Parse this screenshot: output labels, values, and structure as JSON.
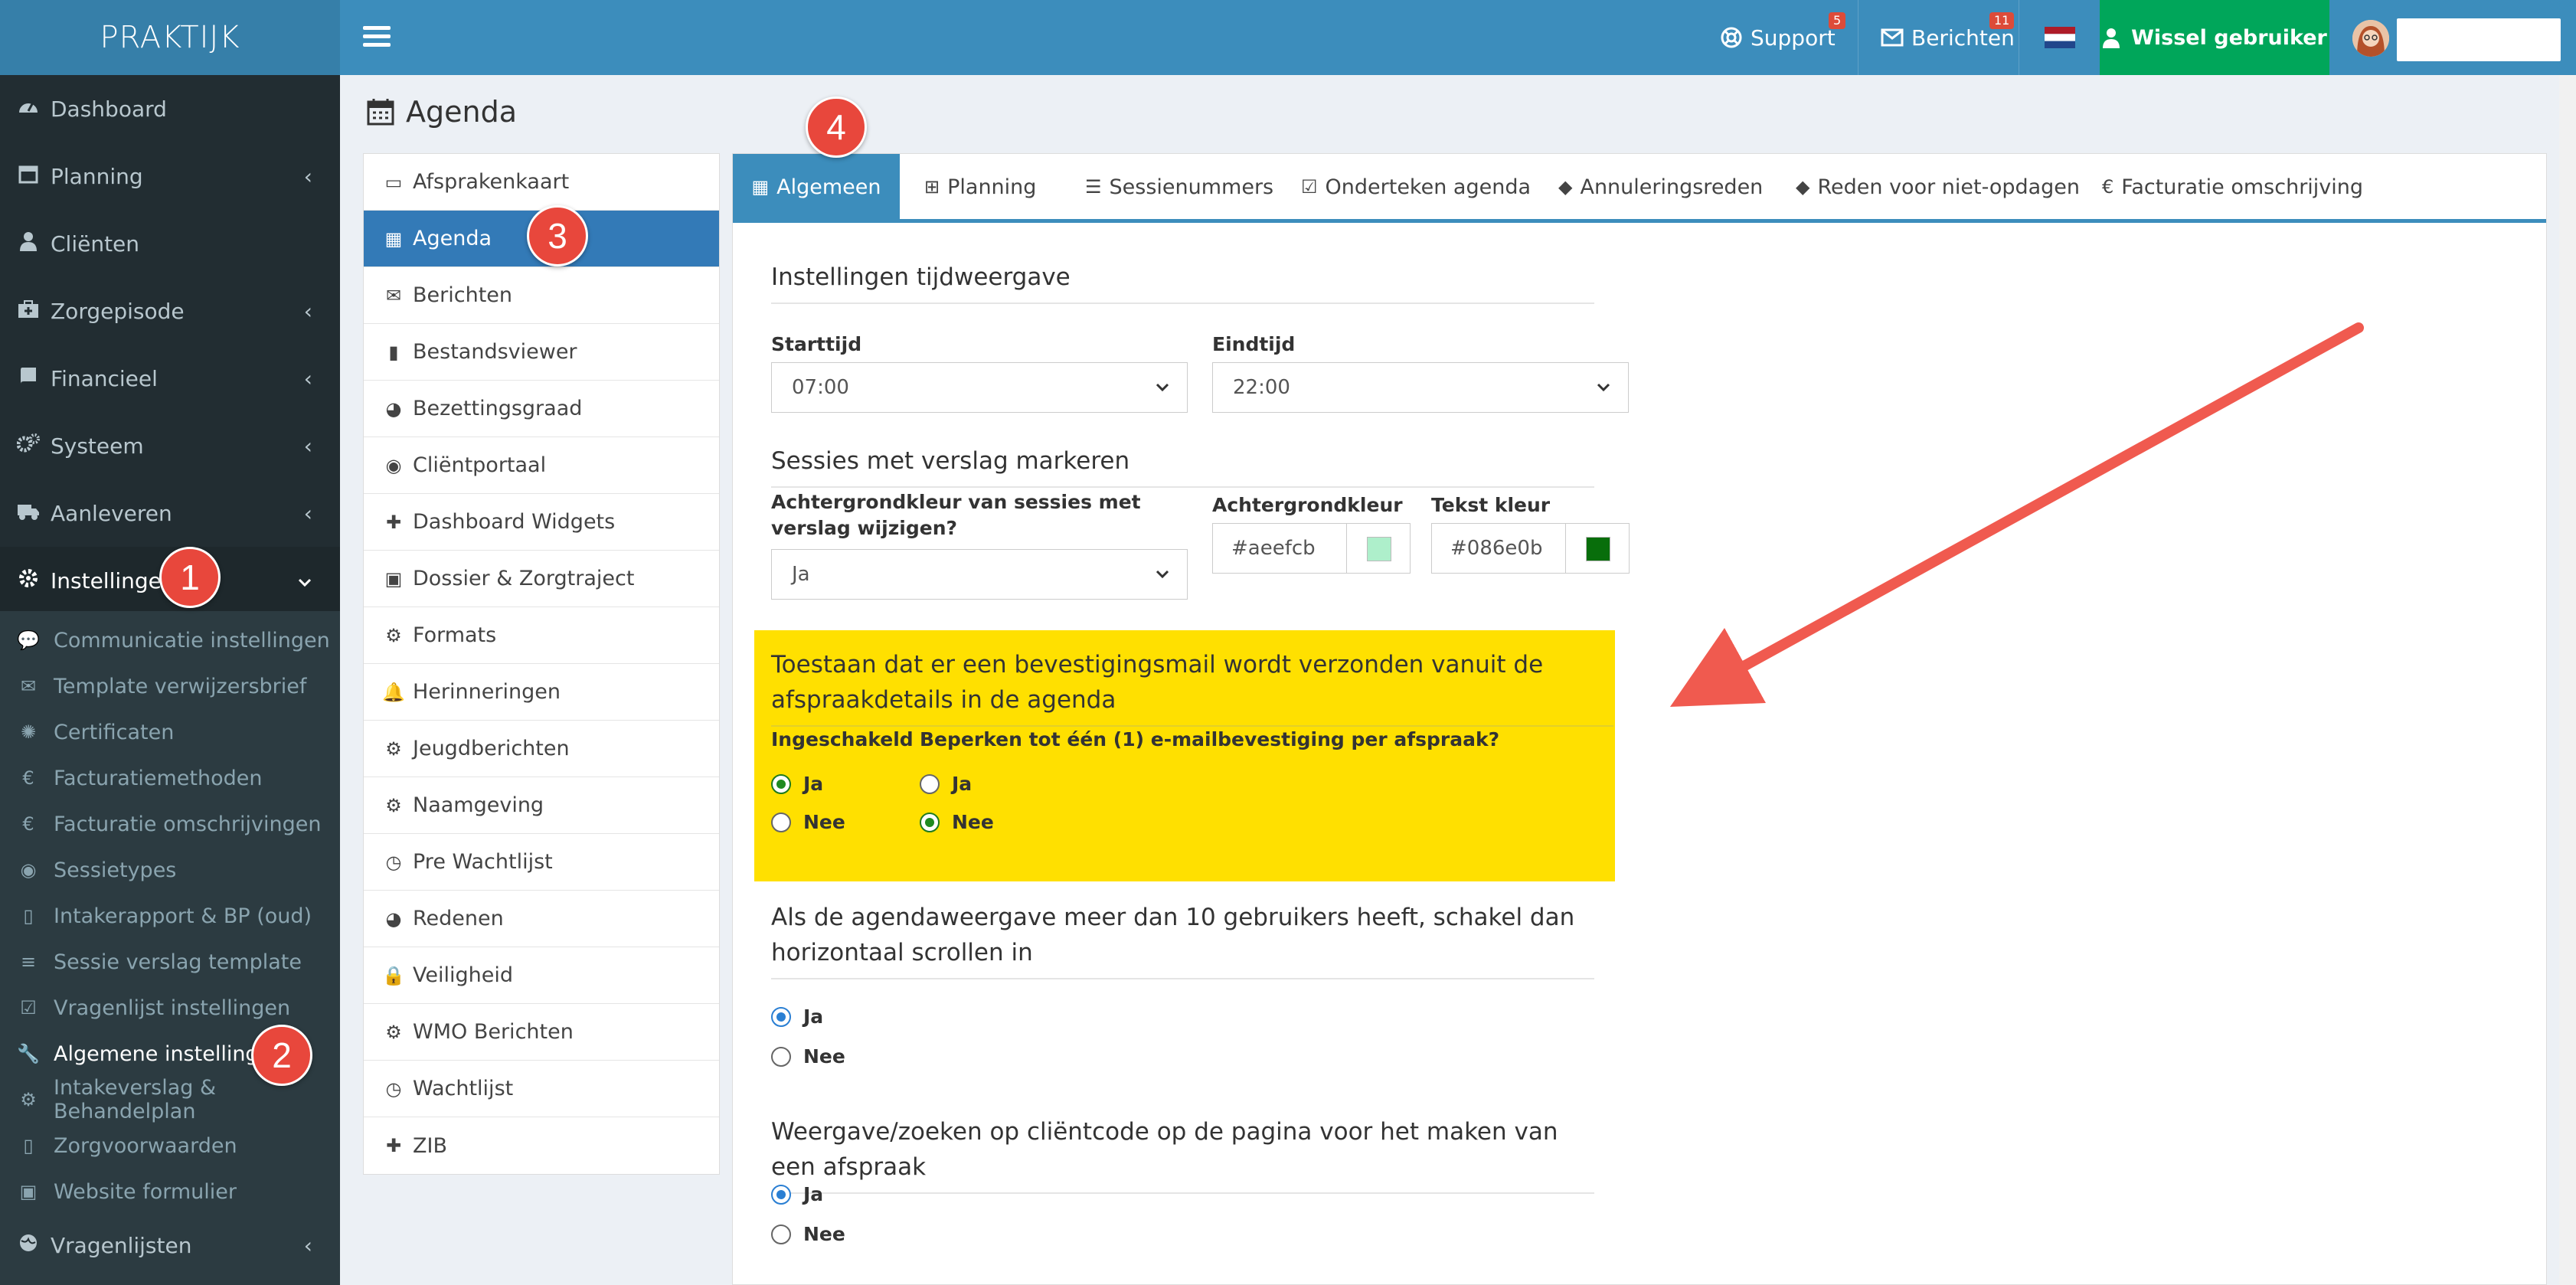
{
  "app": {
    "logo": "PRAKTIJK"
  },
  "topbar": {
    "support_label": "Support",
    "support_badge": "5",
    "berichten_label": "Berichten",
    "berichten_badge": "11",
    "wissel_label": "Wissel gebruiker",
    "flag_icon": "nl-flag-icon"
  },
  "sidebar": {
    "items": [
      {
        "label": "Dashboard",
        "icon": "dashboard-icon"
      },
      {
        "label": "Planning",
        "icon": "calendar-icon"
      },
      {
        "label": "Cliënten",
        "icon": "user-icon"
      },
      {
        "label": "Zorgepisode",
        "icon": "medkit-icon"
      },
      {
        "label": "Financieel",
        "icon": "book-icon"
      },
      {
        "label": "Systeem",
        "icon": "cogs-icon"
      },
      {
        "label": "Aanleveren",
        "icon": "truck-icon"
      },
      {
        "label": "Instellingen",
        "icon": "gear-icon"
      },
      {
        "label": "Vragenlijsten",
        "icon": "globe-icon"
      }
    ],
    "sub_items": [
      {
        "label": "Communicatie instellingen"
      },
      {
        "label": "Template verwijzersbrief"
      },
      {
        "label": "Certificaten"
      },
      {
        "label": "Facturatiemethoden"
      },
      {
        "label": "Facturatie omschrijvingen"
      },
      {
        "label": "Sessietypes"
      },
      {
        "label": "Intakerapport & BP (oud)"
      },
      {
        "label": "Sessie verslag template"
      },
      {
        "label": "Vragenlijst instellingen"
      },
      {
        "label": "Algemene instellingen"
      },
      {
        "label": "Intakeverslag & Behandelplan"
      },
      {
        "label": "Zorgvoorwaarden"
      },
      {
        "label": "Website formulier"
      }
    ]
  },
  "page": {
    "title": "Agenda"
  },
  "leftmenu": {
    "items": [
      {
        "label": "Afsprakenkaart"
      },
      {
        "label": "Agenda"
      },
      {
        "label": "Berichten"
      },
      {
        "label": "Bestandsviewer"
      },
      {
        "label": "Bezettingsgraad"
      },
      {
        "label": "Cliëntportaal"
      },
      {
        "label": "Dashboard Widgets"
      },
      {
        "label": "Dossier & Zorgtraject"
      },
      {
        "label": "Formats"
      },
      {
        "label": "Herinneringen"
      },
      {
        "label": "Jeugdberichten"
      },
      {
        "label": "Naamgeving"
      },
      {
        "label": "Pre Wachtlijst"
      },
      {
        "label": "Redenen"
      },
      {
        "label": "Veiligheid"
      },
      {
        "label": "WMO Berichten"
      },
      {
        "label": "Wachtlijst"
      },
      {
        "label": "ZIB"
      }
    ]
  },
  "tabs": [
    {
      "label": "Algemeen",
      "icon": "calendar-icon"
    },
    {
      "label": "Planning",
      "icon": "calendar-plus-icon"
    },
    {
      "label": "Sessienummers",
      "icon": "list-icon"
    },
    {
      "label": "Onderteken agenda",
      "icon": "calendar-check-icon"
    },
    {
      "label": "Annuleringsreden",
      "icon": "tag-icon"
    },
    {
      "label": "Reden voor niet-opdagen",
      "icon": "tag-icon"
    },
    {
      "label": "Facturatie omschrijving",
      "icon": "euro-icon"
    }
  ],
  "form": {
    "time_section_title": "Instellingen tijdweergave",
    "start_label": "Starttijd",
    "start_value": "07:00",
    "end_label": "Eindtijd",
    "end_value": "22:00",
    "sessions_section_title": "Sessies met verslag markeren",
    "bg_change_label": "Achtergrondkleur van sessies met verslag wijzigen?",
    "bg_change_value": "Ja",
    "bg_color_label": "Achtergrondkleur",
    "bg_color_value": "#aeefcb",
    "text_color_label": "Tekst kleur",
    "text_color_value": "#086e0b",
    "confirm_section_title": "Toestaan dat er een bevestigingsmail wordt verzonden vanuit de afspraakdetails in de agenda",
    "enabled_label": "Ingeschakeld",
    "limit_label": "Beperken tot één (1) e-mailbevestiging per afspraak?",
    "yes": "Ja",
    "no": "Nee",
    "scroll_section_title": "Als de agendaweergave meer dan 10 gebruikers heeft, schakel dan horizontaal scrollen in",
    "clientcode_section_title": "Weergave/zoeken op cliëntcode op de pagina voor het maken van een afspraak"
  },
  "callouts": [
    "1",
    "2",
    "3",
    "4"
  ],
  "colors": {
    "topbar": "#3c8dbc",
    "logo_bg": "#367fa9",
    "sidebar": "#222d32",
    "wissel": "#00a65a",
    "highlight": "#ffe000",
    "callout": "#e8473c",
    "arrow": "#f05a4f"
  }
}
